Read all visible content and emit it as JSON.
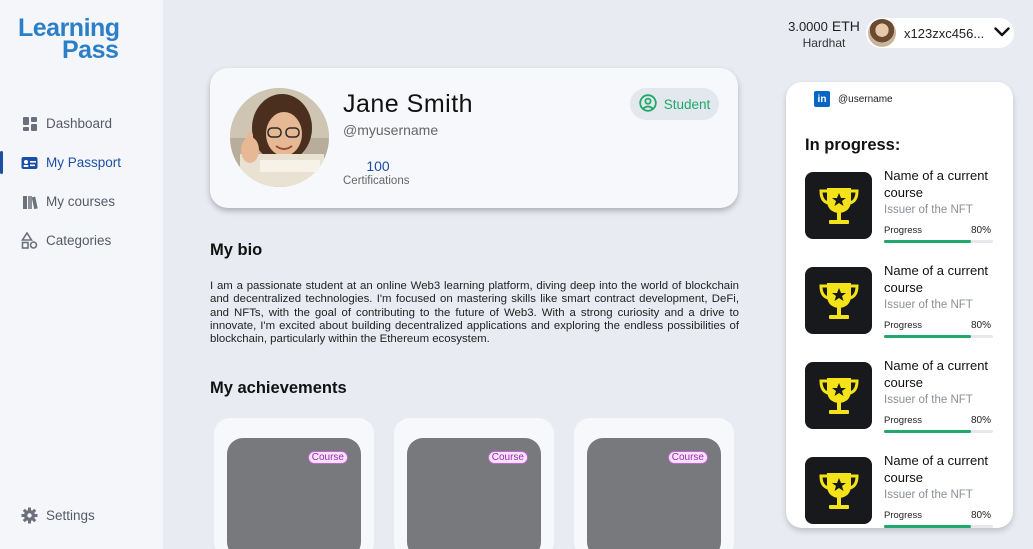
{
  "brand": {
    "line1": "Learning",
    "line2": "Pass"
  },
  "sidebar": {
    "items": [
      {
        "label": "Dashboard",
        "icon": "dashboard-icon"
      },
      {
        "label": "My Passport",
        "icon": "id-card-icon",
        "active": true
      },
      {
        "label": "My courses",
        "icon": "books-icon"
      },
      {
        "label": "Categories",
        "icon": "shapes-icon"
      }
    ],
    "settings_label": "Settings"
  },
  "header": {
    "balance": "3.0000",
    "currency": "ETH",
    "network": "Hardhat",
    "address": "x123zxc456..."
  },
  "profile": {
    "name": "Jane Smith",
    "handle": "@myusername",
    "certifications_count": "100",
    "certifications_label": "Certifications",
    "role": "Student"
  },
  "bio": {
    "title": "My bio",
    "text": "I am a passionate student at an online Web3 learning platform, diving deep into the world of blockchain and decentralized technologies. I'm focused on mastering skills like smart contract development, DeFi, and NFTs, with the goal of contributing to the future of Web3. With a strong curiosity and a drive to innovate, I'm excited about building decentralized applications and exploring the endless possibilities of blockchain, particularly within the Ethereum ecosystem."
  },
  "achievements": {
    "title": "My achievements",
    "items": [
      {
        "badge": "Course"
      },
      {
        "badge": "Course"
      },
      {
        "badge": "Course"
      }
    ]
  },
  "right_panel": {
    "linkedin_user": "@username",
    "title": "In progress:",
    "courses": [
      {
        "name": "Name of a current course",
        "issuer": "Issuer of the NFT",
        "progress_label": "Progress",
        "progress": "80%",
        "progress_value": 0.8
      },
      {
        "name": "Name of a current course",
        "issuer": "Issuer of the NFT",
        "progress_label": "Progress",
        "progress": "80%",
        "progress_value": 0.8
      },
      {
        "name": "Name of a current course",
        "issuer": "Issuer of the NFT",
        "progress_label": "Progress",
        "progress": "80%",
        "progress_value": 0.8
      },
      {
        "name": "Name of a current course",
        "issuer": "Issuer of the NFT",
        "progress_label": "Progress",
        "progress": "80%",
        "progress_value": 0.8
      }
    ]
  },
  "colors": {
    "accent_blue": "#1b4fa3",
    "accent_green": "#1fa86a",
    "trophy_yellow": "#f5e31a",
    "badge_purple": "#9b2bb0"
  }
}
